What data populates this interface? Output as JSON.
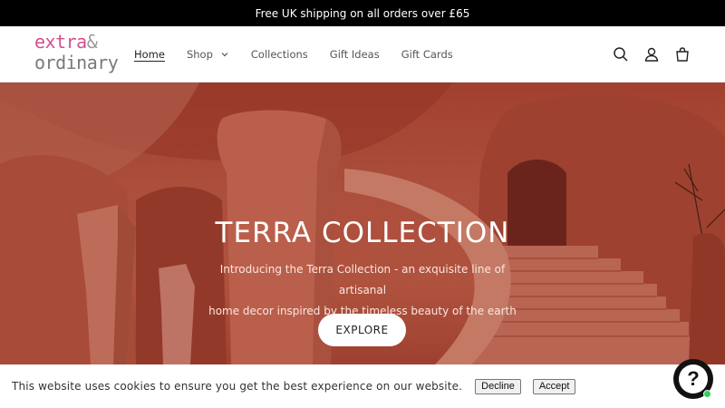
{
  "announcement": {
    "text": "Free UK shipping on all orders over £65"
  },
  "logo": {
    "line1": "extra",
    "amp": "&",
    "line2": "ordinary"
  },
  "nav": {
    "home": "Home",
    "shop": "Shop",
    "collections": "Collections",
    "gift_ideas": "Gift Ideas",
    "gift_cards": "Gift Cards"
  },
  "header_icons": [
    "search-icon",
    "account-icon",
    "cart-icon"
  ],
  "hero": {
    "title": "TERRA COLLECTION",
    "subtitle_line1": "Introducing the Terra Collection - an exquisite line of artisanal",
    "subtitle_line2": "home decor inspired by the timeless beauty of the earth",
    "button": "EXPLORE"
  },
  "cookie": {
    "text": "This website uses cookies to ensure you get the best experience on our website.",
    "decline": "Decline",
    "accept": "Accept"
  },
  "help": {
    "label": "?"
  },
  "colors": {
    "brand_pink": "#d4508f",
    "terracotta": "#c45a45",
    "online_green": "#2fd15a"
  }
}
